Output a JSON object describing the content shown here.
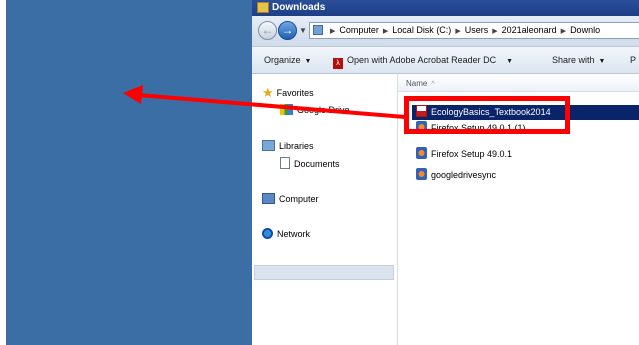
{
  "window": {
    "title": "Downloads"
  },
  "address": {
    "crumbs": [
      "Computer",
      "Local Disk (C:)",
      "Users",
      "2021aleonard",
      "Downlo"
    ]
  },
  "toolbar": {
    "organize": "Organize",
    "open_with": "Open with Adobe Acrobat Reader DC",
    "share_with": "Share with",
    "partial": "P"
  },
  "nav": {
    "favorites": "Favorites",
    "google_drive": "Google Drive",
    "libraries": "Libraries",
    "documents": "Documents",
    "computer": "Computer",
    "network": "Network"
  },
  "files": {
    "header_name": "Name",
    "items": [
      {
        "name": "EcologyBasics_Textbook2014",
        "icon": "pdf-icon"
      },
      {
        "name": "Firefox Setup 49.0.1 (1)",
        "icon": "setup-icon"
      },
      {
        "name": "Firefox Setup 49.0.1",
        "icon": "setup-icon"
      },
      {
        "name": "googledrivesync",
        "icon": "setup-icon"
      }
    ]
  },
  "annotation": {
    "color": "#ff0000"
  },
  "colors": {
    "desktop": "#3a6ea5",
    "selection": "#0a246a"
  }
}
